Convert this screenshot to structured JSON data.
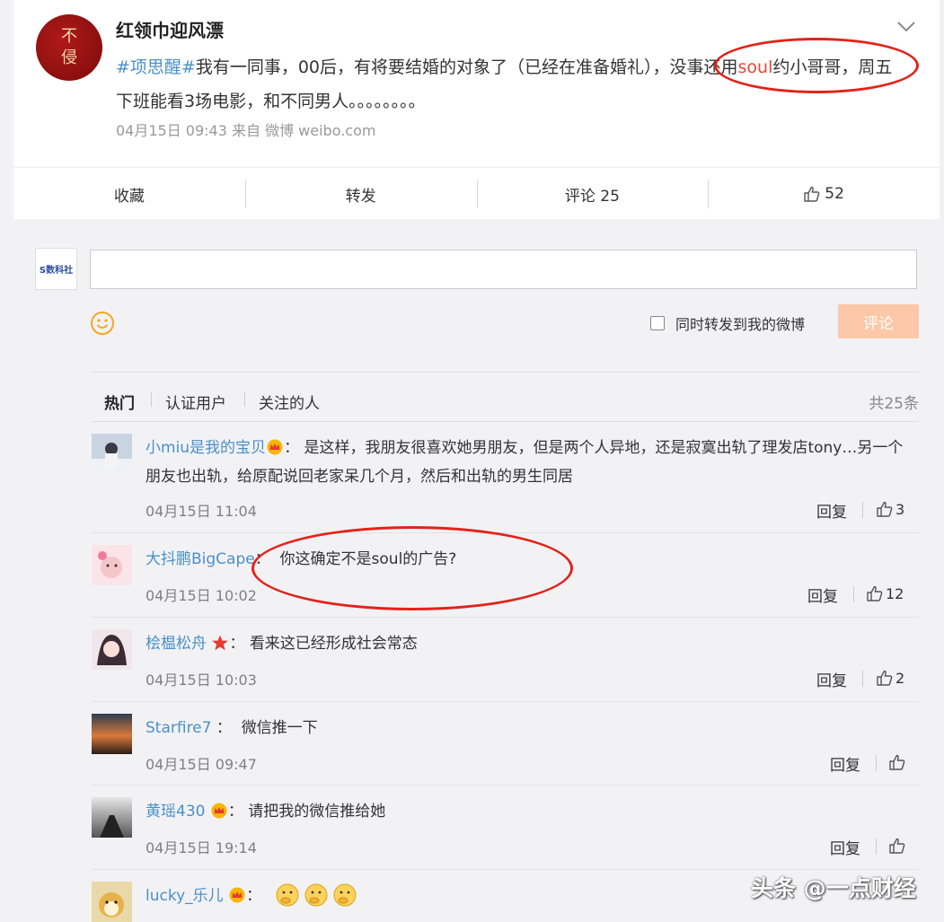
{
  "post": {
    "author": "红领巾迎风漂",
    "avatar_text": [
      "不",
      "侵"
    ],
    "hashtag": "#项思醒#",
    "text_before": "我有一同事，00后，有将要结婚的对象了（已经在准备婚礼），没事还用",
    "highlight": "soul",
    "text_after": "约小哥哥，周五下班能看3场电影，和不同男人。。。。。。。。",
    "meta": "04月15日 09:43  来自 微博 weibo.com"
  },
  "actions": {
    "favorite": "收藏",
    "repost": "转发",
    "comment": "评论 25",
    "like": "52"
  },
  "composer": {
    "my_avatar_text": "S数科社",
    "repost_label": "同时转发到我的微博",
    "submit_label": "评论"
  },
  "filter": {
    "hot": "热门",
    "verified": "认证用户",
    "following": "关注的人",
    "total": "共25条"
  },
  "comments": [
    {
      "name": "小miu是我的宝贝",
      "text": "是这样，我朋友很喜欢她男朋友，但是两个人异地，还是寂寞出轨了理发店tony…另一个朋友也出轨，给原配说回老家呆几个月，然后和出轨的男生同居",
      "date": "04月15日 11:04",
      "reply": "回复",
      "likes": "3"
    },
    {
      "name": "大抖鹏BigCape",
      "text": "你这确定不是soul的广告?",
      "date": "04月15日 10:02",
      "reply": "回复",
      "likes": "12"
    },
    {
      "name": "桧榅松舟",
      "text": "看来这已经形成社会常态",
      "date": "04月15日 10:03",
      "reply": "回复",
      "likes": "2"
    },
    {
      "name": "Starfire7",
      "text": "微信推一下",
      "date": "04月15日 09:47",
      "reply": "回复",
      "likes": ""
    },
    {
      "name": "黄瑶430",
      "text": "请把我的微信推给她",
      "date": "04月15日 19:14",
      "reply": "回复",
      "likes": ""
    },
    {
      "name": "lucky_乐儿",
      "text": "",
      "date": "",
      "reply": "",
      "likes": ""
    }
  ],
  "watermark": "头条 @一点财经",
  "colors": {
    "link": "#4a90c8",
    "highlight": "#e8473a",
    "annotation": "#e2231a",
    "submit": "#fdc8a8"
  }
}
